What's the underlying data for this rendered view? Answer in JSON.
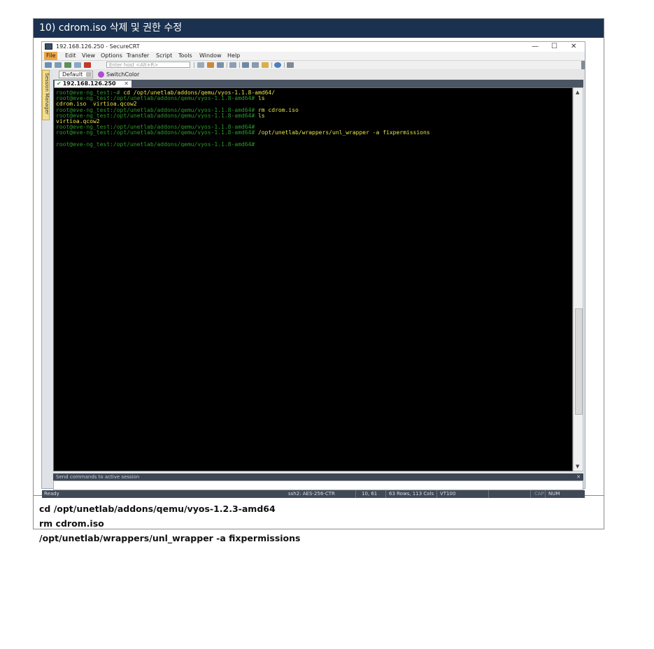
{
  "doc": {
    "header": "10) cdrom.iso 삭제 및 권한 수정",
    "notes": [
      "cd /opt/unetlab/addons/qemu/vyos-1.2.3-amd64",
      "rm cdrom.iso",
      "/opt/unetlab/wrappers/unl_wrapper -a fixpermissions"
    ]
  },
  "window": {
    "title": "192.168.126.250 - SecureCRT",
    "controls": {
      "minimize": "—",
      "maximize": "☐",
      "close": "✕"
    },
    "menu": [
      "File",
      "Edit",
      "View",
      "Options",
      "Transfer",
      "Script",
      "Tools",
      "Window",
      "Help"
    ],
    "toolbar": {
      "host_placeholder": "Enter host <Alt+R>"
    },
    "side_tab": "Session Manager",
    "button_bar": {
      "default": "Default",
      "switch_color": "SwitchColor"
    },
    "session_tab": {
      "label": "192.168.126.250",
      "close": "✕"
    },
    "terminal_lines": [
      {
        "prompt": "root@eve-ng_test:~# ",
        "cmd": "cd /opt/unetlab/addons/qemu/vyos-1.1.8-amd64/"
      },
      {
        "prompt": "root@eve-ng_test:/opt/unetlab/addons/qemu/vyos-1.1.8-amd64# ",
        "cmd": "ls"
      },
      {
        "prompt": "",
        "cmd": "cdrom.iso  virtioa.qcow2"
      },
      {
        "prompt": "root@eve-ng_test:/opt/unetlab/addons/qemu/vyos-1.1.8-amd64# ",
        "cmd": "rm cdrom.iso"
      },
      {
        "prompt": "root@eve-ng_test:/opt/unetlab/addons/qemu/vyos-1.1.8-amd64# ",
        "cmd": "ls"
      },
      {
        "prompt": "",
        "cmd": "virtioa.qcow2"
      },
      {
        "prompt": "root@eve-ng_test:/opt/unetlab/addons/qemu/vyos-1.1.8-amd64# ",
        "cmd": ""
      },
      {
        "prompt": "root@eve-ng_test:/opt/unetlab/addons/qemu/vyos-1.1.8-amd64# ",
        "cmd": "/opt/unetlab/wrappers/unl_wrapper -a fixpermissions"
      },
      {
        "prompt": "",
        "cmd": ""
      },
      {
        "prompt": "root@eve-ng_test:/opt/unetlab/addons/qemu/vyos-1.1.8-amd64# ",
        "cmd": ""
      }
    ],
    "send_bar": "Send commands to active session",
    "send_close": "✕",
    "status": {
      "ready": "Ready",
      "cipher": "ssh2: AES-256-CTR",
      "cursor": "10, 61",
      "size": "63 Rows, 113 Cols",
      "term": "VT100",
      "cap": "CAP",
      "num": "NUM"
    },
    "colors": {
      "prompt": "#2c9a2c",
      "command": "#e6e64a",
      "terminal_bg": "#000000",
      "header_bg": "#1b3150"
    }
  }
}
